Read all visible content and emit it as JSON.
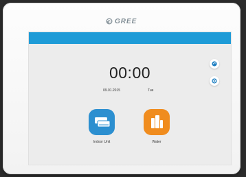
{
  "device": {
    "brand": "GREE"
  },
  "screen": {
    "time": "00:00",
    "date": "09.01.2015",
    "weekday": "Tue"
  },
  "side_buttons": [
    {
      "icon": "mode-icon"
    },
    {
      "icon": "settings-gear-icon"
    }
  ],
  "apps": [
    {
      "label": "Indoor Unit",
      "icon": "indoor-unit-icon",
      "color": "#2c8fd0"
    },
    {
      "label": "Water",
      "icon": "water-tank-icon",
      "color": "#f08c1e"
    }
  ],
  "colors": {
    "top_bar": "#1e9bd7",
    "screen_bg": "#ececec"
  }
}
